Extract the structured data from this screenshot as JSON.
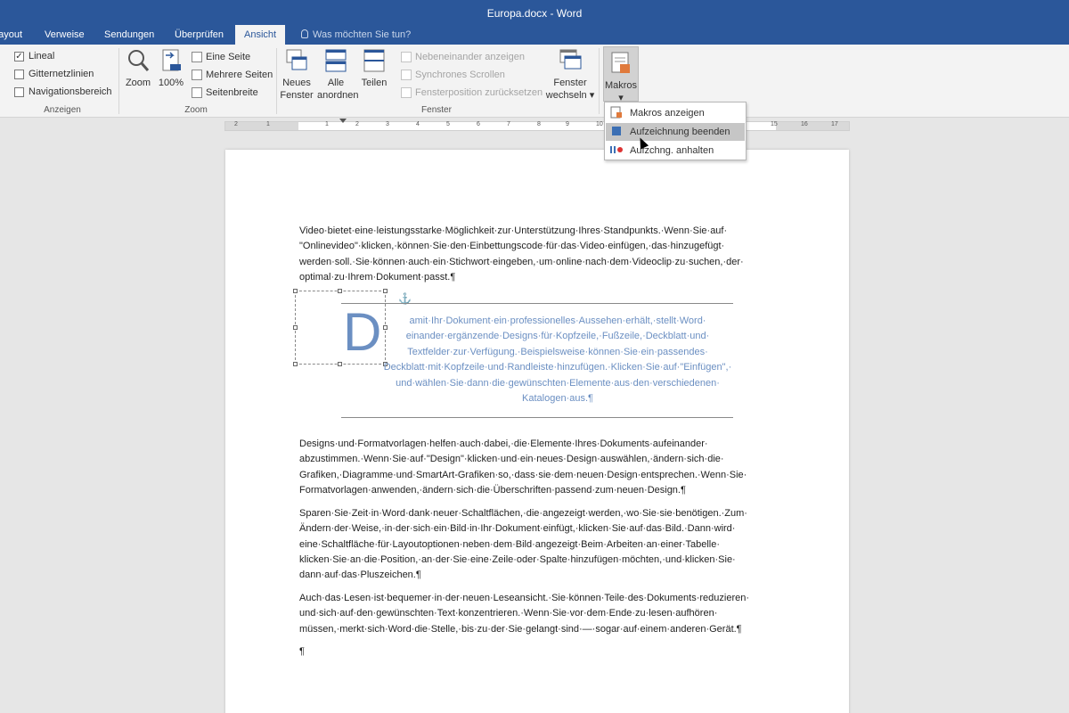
{
  "window": {
    "title": "Europa.docx - Word"
  },
  "tabs": [
    {
      "label": "Layout"
    },
    {
      "label": "Verweise"
    },
    {
      "label": "Sendungen"
    },
    {
      "label": "Überprüfen"
    },
    {
      "label": "Ansicht"
    }
  ],
  "tellme": {
    "placeholder": "Was möchten Sie tun?"
  },
  "ribbon": {
    "anzeigen": {
      "group_label": "Anzeigen",
      "lineal": {
        "label": "Lineal",
        "checked": true
      },
      "gitternetzlinien": {
        "label": "Gitternetzlinien",
        "checked": false
      },
      "navigationsbereich": {
        "label": "Navigationsbereich",
        "checked": false
      }
    },
    "zoom": {
      "group_label": "Zoom",
      "zoom_label": "Zoom",
      "percent_label": "100%",
      "eine_seite": "Eine Seite",
      "mehrere_seiten": "Mehrere Seiten",
      "seitenbreite": "Seitenbreite"
    },
    "fenster": {
      "group_label": "Fenster",
      "neues_fenster_1": "Neues",
      "neues_fenster_2": "Fenster",
      "alle_anordnen_1": "Alle",
      "alle_anordnen_2": "anordnen",
      "teilen": "Teilen",
      "nebeneinander": "Nebeneinander anzeigen",
      "synchron": "Synchrones Scrollen",
      "position": "Fensterposition zurücksetzen",
      "wechseln_1": "Fenster",
      "wechseln_2": "wechseln"
    },
    "makros": {
      "label": "Makros"
    }
  },
  "ruler": {
    "numbers": [
      "2",
      "1",
      "1",
      "2",
      "3",
      "4",
      "5",
      "6",
      "7",
      "8",
      "9",
      "10",
      "11",
      "12",
      "13",
      "14",
      "15",
      "16",
      "17",
      "18"
    ]
  },
  "macro_menu": {
    "items": [
      {
        "label": "Makros anzeigen",
        "icon": "macros-icon"
      },
      {
        "label": "Aufzeichnung beenden",
        "icon": "stop-recording-icon"
      },
      {
        "label": "Aufzchng. anhalten",
        "icon": "pause-recording-icon"
      }
    ]
  },
  "document": {
    "para1": "Video·bietet·eine·leistungsstarke·Möglichkeit·zur·Unterstützung·Ihres·Standpunkts.·Wenn·Sie·auf· \"Onlinevideo\"·klicken,·können·Sie·den·Einbettungscode·für·das·Video·einfügen,·das·hinzugefügt· werden·soll.·Sie·können·auch·ein·Stichwort·eingeben,·um·online·nach·dem·Videoclip·zu·suchen,·der· optimal·zu·Ihrem·Dokument·passt.¶",
    "dropcap": "D",
    "callout": "amit·Ihr·Dokument·ein·professionelles·Aussehen·erhält,·stellt·Word· einander·ergänzende·Designs·für·Kopfzeile,·Fußzeile,·Deckblatt·und· Textfelder·zur·Verfügung.·Beispielsweise·können·Sie·ein·passendes· Deckblatt·mit·Kopfzeile·und·Randleiste·hinzufügen.·Klicken·Sie·auf·\"Einfügen\",· und·wählen·Sie·dann·die·gewünschten·Elemente·aus·den·verschiedenen· Katalogen·aus.¶",
    "para2": "Designs·und·Formatvorlagen·helfen·auch·dabei,·die·Elemente·Ihres·Dokuments·aufeinander· abzustimmen.·Wenn·Sie·auf·\"Design\"·klicken·und·ein·neues·Design·auswählen,·ändern·sich·die· Grafiken,·Diagramme·und·SmartArt-Grafiken·so,·dass·sie·dem·neuen·Design·entsprechen.·Wenn·Sie· Formatvorlagen·anwenden,·ändern·sich·die·Überschriften·passend·zum·neuen·Design.¶",
    "para3": "Sparen·Sie·Zeit·in·Word·dank·neuer·Schaltflächen,·die·angezeigt·werden,·wo·Sie·sie·benötigen.·Zum· Ändern·der·Weise,·in·der·sich·ein·Bild·in·Ihr·Dokument·einfügt,·klicken·Sie·auf·das·Bild.·Dann·wird· eine·Schaltfläche·für·Layoutoptionen·neben·dem·Bild·angezeigt·Beim·Arbeiten·an·einer·Tabelle· klicken·Sie·an·die·Position,·an·der·Sie·eine·Zeile·oder·Spalte·hinzufügen·möchten,·und·klicken·Sie· dann·auf·das·Pluszeichen.¶",
    "para4": "Auch·das·Lesen·ist·bequemer·in·der·neuen·Leseansicht.·Sie·können·Teile·des·Dokuments·reduzieren· und·sich·auf·den·gewünschten·Text·konzentrieren.·Wenn·Sie·vor·dem·Ende·zu·lesen·aufhören· müssen,·merkt·sich·Word·die·Stelle,·bis·zu·der·Sie·gelangt·sind·—·sogar·auf·einem·anderen·Gerät.¶",
    "empty_pilcrow": "¶"
  },
  "colors": {
    "accent": "#2b579a",
    "callout_text": "#6b8fc2",
    "ribbon_bg": "#f3f3f3",
    "app_bg": "#e6e6e6"
  }
}
